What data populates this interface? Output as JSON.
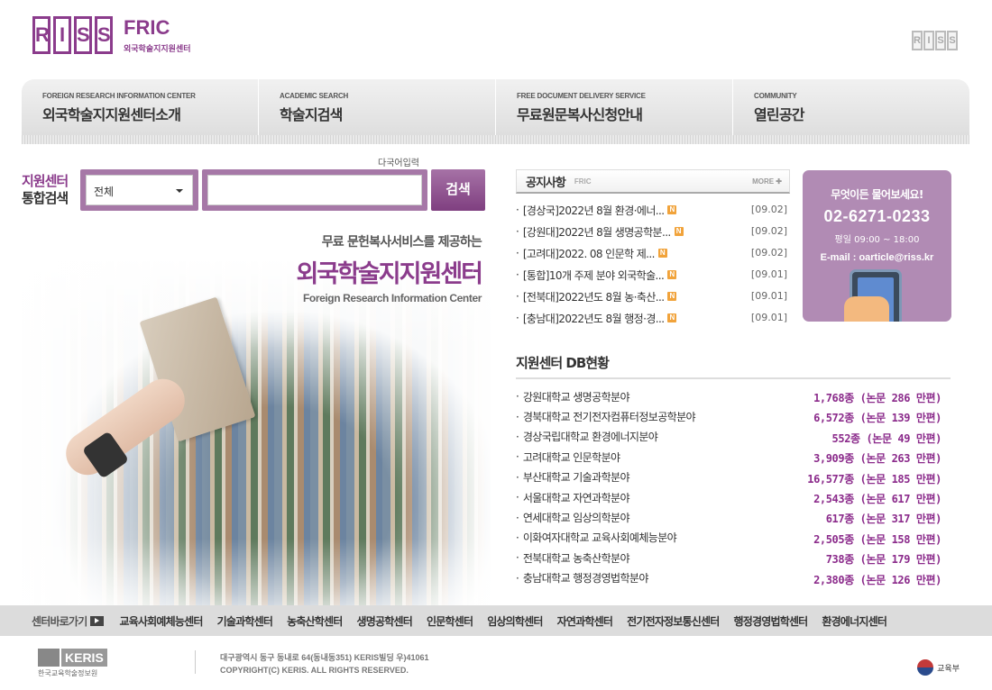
{
  "header": {
    "logo_riss": [
      "R",
      "I",
      "S",
      "S"
    ],
    "logo_fric": "FRIC",
    "logo_fric_sub": "외국학술지지원센터",
    "logo_right": [
      "R",
      "I",
      "S",
      "S"
    ]
  },
  "nav": {
    "items": [
      {
        "en": "FOREIGN RESEARCH INFORMATION CENTER",
        "ko": "외국학술지지원센터소개"
      },
      {
        "en": "ACADEMIC SEARCH",
        "ko": "학술지검색"
      },
      {
        "en": "FREE DOCUMENT DELIVERY SERVICE",
        "ko": "무료원문복사신청안내"
      },
      {
        "en": "COMMUNITY",
        "ko": "열린공간"
      }
    ]
  },
  "search": {
    "label_line1": "지원센터",
    "label_line2": "통합검색",
    "multi_input": "다국어입력",
    "select_value": "전체",
    "input_value": "",
    "button": "검색"
  },
  "hero": {
    "sub": "무료 문헌복사서비스를 제공하는",
    "title": "외국학술지지원센터",
    "en": "Foreign Research Information Center"
  },
  "notice": {
    "title": "공지사항",
    "sub": "FRIC",
    "more": "MORE ✚",
    "items": [
      {
        "text": "[경상국]2022년 8월 환경·에너...",
        "date": "[09.02]"
      },
      {
        "text": "[강원대]2022년 8월 생명공학분...",
        "date": "[09.02]"
      },
      {
        "text": "[고려대]2022. 08 인문학 제...",
        "date": "[09.02]"
      },
      {
        "text": "[통합]10개 주제 분야 외국학술...",
        "date": "[09.01]"
      },
      {
        "text": "[전북대]2022년도 8월 농·축산...",
        "date": "[09.01]"
      },
      {
        "text": "[충남대]2022년도 8월 행정·경...",
        "date": "[09.01]"
      }
    ],
    "new_badge": "N"
  },
  "ask": {
    "question": "무엇이든 물어보세요!",
    "tel": "02-6271-0233",
    "hours": "평일 09:00 ~ 18:00",
    "email": "E-mail : oarticle@riss.kr"
  },
  "db": {
    "title": "지원센터 DB현황",
    "items": [
      {
        "name": "강원대학교 생명공학분야",
        "value": "1,768종 (논문  286 만편)"
      },
      {
        "name": "경북대학교 전기전자컴퓨터정보공학분야",
        "value": "6,572종 (논문  139 만편)"
      },
      {
        "name": "경상국립대학교 환경에너지분야",
        "value": "552종 (논문  49 만편)"
      },
      {
        "name": "고려대학교 인문학분야",
        "value": "3,909종 (논문  263 만편)"
      },
      {
        "name": "부산대학교 기술과학분야",
        "value": "16,577종 (논문  185 만편)"
      },
      {
        "name": "서울대학교 자연과학분야",
        "value": "2,543종 (논문  617 만편)"
      },
      {
        "name": "연세대학교 임상의학분야",
        "value": "617종 (논문  317 만편)"
      },
      {
        "name": "이화여자대학교 교육사회예체능분야",
        "value": "2,505종 (논문  158 만편)"
      },
      {
        "name": "전북대학교 농축산학분야",
        "value": "738종 (논문  179 만편)"
      },
      {
        "name": "충남대학교 행정경영법학분야",
        "value": "2,380종 (논문  126 만편)"
      }
    ]
  },
  "centers": {
    "label": "센터바로가기",
    "items": [
      "교육사회예체능센터",
      "기술과학센터",
      "농축산학센터",
      "생명공학센터",
      "인문학센터",
      "임상의학센터",
      "자연과학센터",
      "전기전자정보통신센터",
      "행정경영법학센터",
      "환경에너지센터"
    ]
  },
  "footer": {
    "keris": "KERIS",
    "keris_sub": "한국교육학술정보원",
    "address": "대구광역시 동구 동내로 64(동내동351) KERIS빌딩 우)41061",
    "copyright": "COPYRIGHT(C) KERIS. ALL RIGHTS RESERVED.",
    "ministry": "교육부"
  },
  "colors": {
    "accent": "#8b3c8c",
    "accent_light": "#a678a7",
    "ask_bg": "#b18bb4",
    "value": "#8b2b8b"
  }
}
